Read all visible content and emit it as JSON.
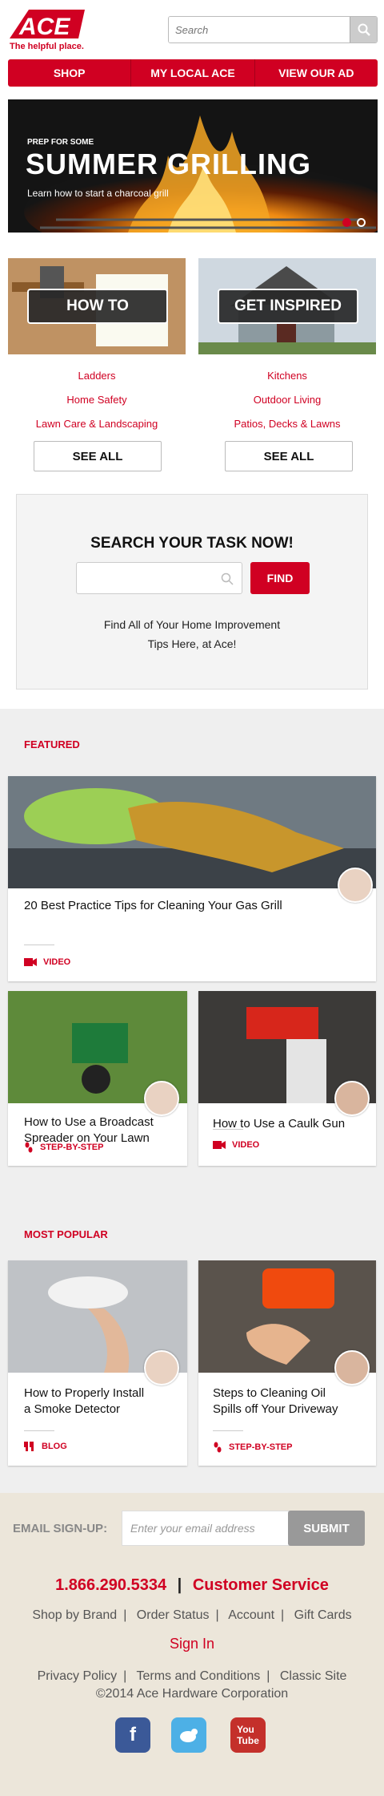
{
  "header": {
    "tagline": "The helpful place.",
    "search_placeholder": "Search"
  },
  "nav": [
    "SHOP",
    "MY LOCAL ACE",
    "VIEW OUR AD"
  ],
  "hero": {
    "eyebrow": "PREP FOR SOME",
    "title": "SUMMER GRILLING",
    "subtitle": "Learn how to start a charcoal grill",
    "active_slide": 1,
    "total_slides": 2
  },
  "howto": {
    "label": "HOW TO",
    "links": [
      "Ladders",
      "Home Safety",
      "Lawn Care & Landscaping"
    ],
    "see_all": "SEE ALL"
  },
  "inspired": {
    "label": "GET INSPIRED",
    "links": [
      "Kitchens",
      "Outdoor Living",
      "Patios, Decks & Lawns"
    ],
    "see_all": "SEE ALL"
  },
  "task_search": {
    "title": "SEARCH YOUR TASK NOW!",
    "find_label": "FIND",
    "copy_line1": "Find All of Your Home Improvement",
    "copy_line2": "Tips Here, at Ace!"
  },
  "featured": {
    "heading": "FEATURED",
    "main": {
      "title": "20 Best Practice Tips for Cleaning Your Gas Grill",
      "tag": "VIDEO"
    },
    "cards": [
      {
        "title_line1": "How to Use a Broadcast",
        "title_line2": "Spreader on Your Lawn",
        "tag": "STEP-BY-STEP"
      },
      {
        "title_line1": "How to Use a Caulk Gun",
        "title_line2": "",
        "tag": "VIDEO"
      }
    ]
  },
  "popular": {
    "heading": "MOST POPULAR",
    "cards": [
      {
        "title_line1": "How to Properly Install",
        "title_line2": "a Smoke Detector",
        "tag": "BLOG"
      },
      {
        "title_line1": "Steps to Cleaning Oil",
        "title_line2": "Spills off Your Driveway",
        "tag": "STEP-BY-STEP"
      }
    ]
  },
  "footer": {
    "email_label": "EMAIL SIGN-UP:",
    "email_placeholder": "Enter your email address",
    "submit_label": "SUBMIT",
    "phone": "1.866.290.5334",
    "phone_sep": "|",
    "customer_service": "Customer Service",
    "links_row1": [
      "Shop by Brand",
      "Order Status",
      "Account",
      "Gift Cards"
    ],
    "sign_in": "Sign In",
    "links_row2": [
      "Privacy Policy",
      "Terms and Conditions",
      "Classic Site"
    ],
    "copyright": "©2014 Ace Hardware Corporation",
    "social": [
      "facebook-icon",
      "twitter-icon",
      "youtube-icon"
    ]
  },
  "colors": {
    "brand_red": "#d00022",
    "footer_bg": "#ece6da"
  }
}
